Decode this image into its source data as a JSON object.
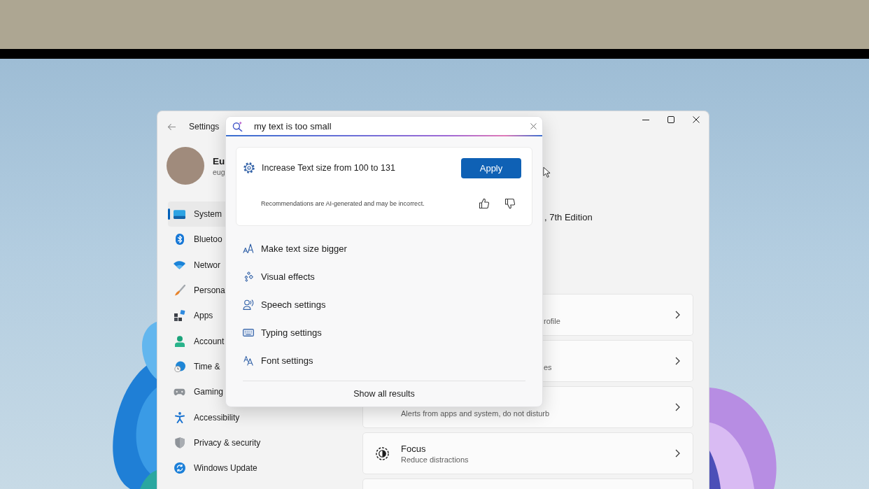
{
  "window": {
    "title": "Settings"
  },
  "profile": {
    "name": "Eu",
    "email": "eug"
  },
  "sidebar": {
    "items": [
      {
        "label": "System",
        "selected": true
      },
      {
        "label": "Bluetoo",
        "selected": false
      },
      {
        "label": "Networ",
        "selected": false
      },
      {
        "label": "Persona",
        "selected": false
      },
      {
        "label": "Apps",
        "selected": false
      },
      {
        "label": "Account",
        "selected": false
      },
      {
        "label": "Time &",
        "selected": false
      },
      {
        "label": "Gaming",
        "selected": false
      },
      {
        "label": "Accessibility",
        "selected": false
      },
      {
        "label": "Privacy & security",
        "selected": false
      },
      {
        "label": "Windows Update",
        "selected": false
      }
    ]
  },
  "content": {
    "device_info": ", 7th Edition",
    "cards": [
      {
        "kind": "fragment",
        "subtitle": "rofile"
      },
      {
        "kind": "fragment",
        "subtitle": "es"
      },
      {
        "kind": "subtitle",
        "subtitle": "Alerts from apps and system, do not disturb"
      },
      {
        "kind": "full",
        "title": "Focus",
        "subtitle": "Reduce distractions"
      },
      {
        "kind": "blank"
      }
    ]
  },
  "search": {
    "value": "my text is too small",
    "recommendation": {
      "text": "Increase Text size from 100 to 131",
      "button": "Apply",
      "disclaimer": "Recommendations are AI-generated and may be incorrect."
    },
    "results": [
      {
        "label": "Make text size bigger"
      },
      {
        "label": "Visual effects"
      },
      {
        "label": "Speech settings"
      },
      {
        "label": "Typing settings"
      },
      {
        "label": "Font settings"
      }
    ],
    "show_all": "Show all results"
  }
}
